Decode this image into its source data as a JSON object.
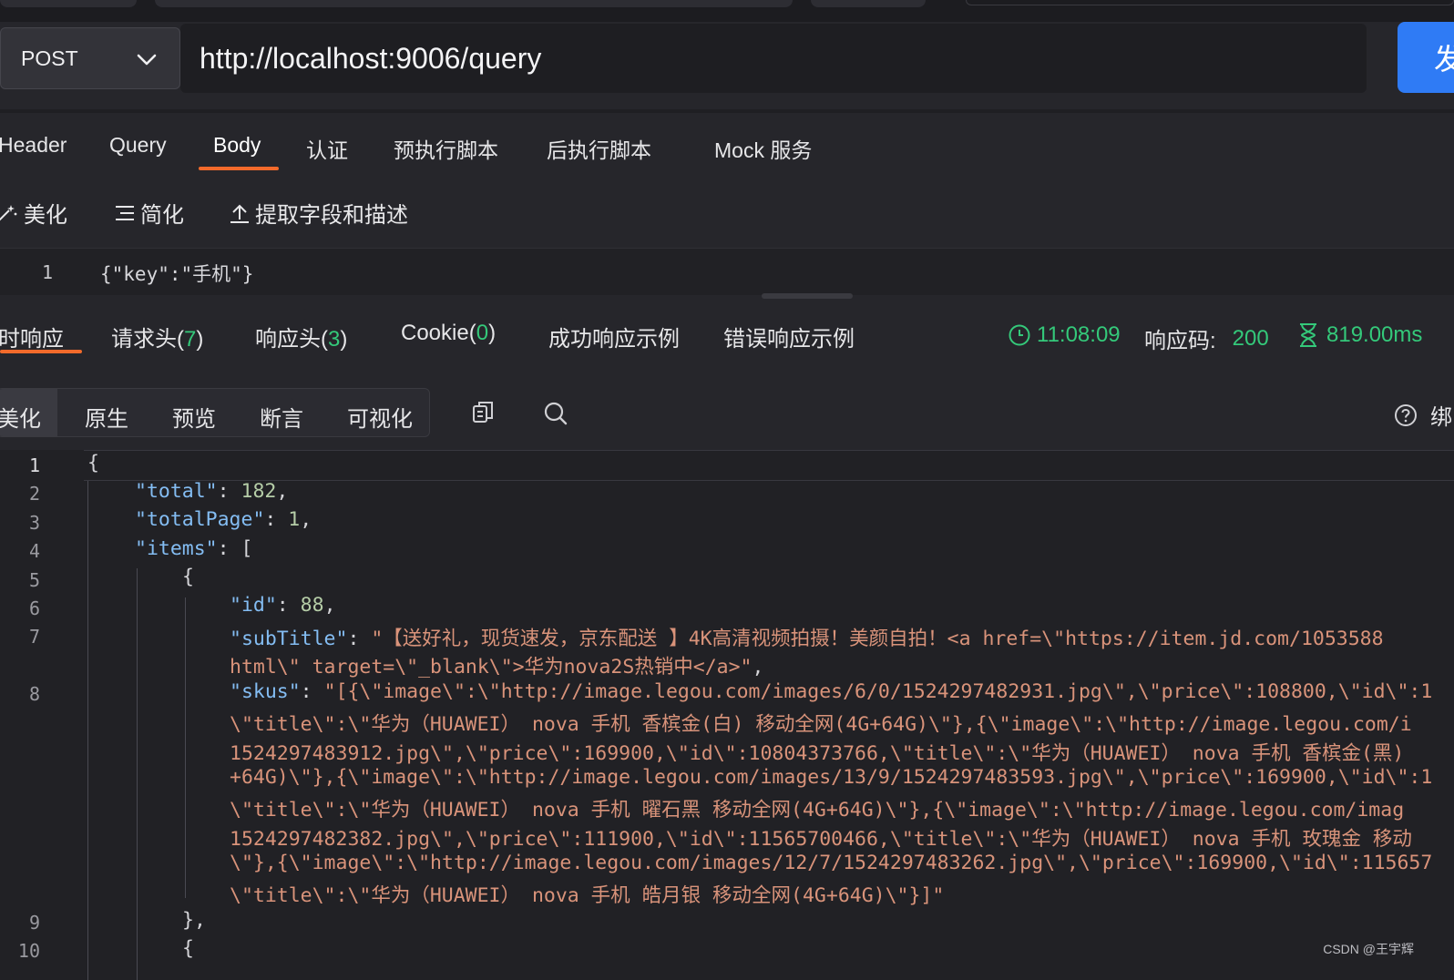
{
  "request": {
    "method": "POST",
    "url": "http://localhost:9006/query",
    "send_label": "发",
    "tabs": [
      "Header",
      "Query",
      "Body",
      "认证",
      "预执行脚本",
      "后执行脚本",
      "Mock 服务"
    ],
    "active_tab": "Body",
    "body_tools": {
      "beautify": "美化",
      "simplify": "简化",
      "extract": "提取字段和描述"
    },
    "body_line_number": "1",
    "body": "{\"key\":\"手机\"}"
  },
  "response": {
    "tabs": {
      "realtime": "时响应",
      "req_headers": "请求头(",
      "req_headers_count": "7",
      "resp_headers": "响应头(",
      "resp_headers_count": "3",
      "cookie": "Cookie(",
      "cookie_count": "0",
      "close_paren": ")",
      "success_example": "成功响应示例",
      "error_example": "错误响应示例"
    },
    "time": "11:08:09",
    "status_label": "响应码:",
    "status_code": "200",
    "duration": "819.00ms",
    "view_modes": [
      "美化",
      "原生",
      "预览",
      "断言",
      "可视化"
    ],
    "active_view": "美化",
    "bind_label": "绑",
    "line_numbers": [
      "1",
      "2",
      "3",
      "4",
      "5",
      "6",
      "7",
      "8",
      "9",
      "10"
    ],
    "code": {
      "l1": "{",
      "total_key": "\"total\"",
      "total_val": "182",
      "totalpage_key": "\"totalPage\"",
      "totalpage_val": "1",
      "items_key": "\"items\"",
      "items_open": "[",
      "obj_open": "{",
      "id_key": "\"id\"",
      "id_val": "88",
      "subtitle_key": "\"subTitle\"",
      "subtitle_val_1": "\"【送好礼，现货速发，京东配送 】4K高清视频拍摄！美颜自拍！<a href=\\\"https://item.jd.com/1053588",
      "subtitle_val_2": "html\\\" target=\\\"_blank\\\">华为nova2S热销中</a>\"",
      "skus_key": "\"skus\"",
      "skus_val_1": "\"[{\\\"image\\\":\\\"http://image.legou.com/images/6/0/1524297482931.jpg\\\",\\\"price\\\":108800,\\\"id\\\":1",
      "skus_val_2": "\\\"title\\\":\\\"华为（HUAWEI） nova 手机 香槟金(白) 移动全网(4G+64G)\\\"},{\\\"image\\\":\\\"http://image.legou.com/i",
      "skus_val_3": "1524297483912.jpg\\\",\\\"price\\\":169900,\\\"id\\\":10804373766,\\\"title\\\":\\\"华为（HUAWEI） nova 手机 香槟金(黑)",
      "skus_val_4": "+64G)\\\"},{\\\"image\\\":\\\"http://image.legou.com/images/13/9/1524297483593.jpg\\\",\\\"price\\\":169900,\\\"id\\\":1",
      "skus_val_5": "\\\"title\\\":\\\"华为（HUAWEI） nova 手机 曜石黑 移动全网(4G+64G)\\\"},{\\\"image\\\":\\\"http://image.legou.com/imag",
      "skus_val_6": "1524297482382.jpg\\\",\\\"price\\\":111900,\\\"id\\\":11565700466,\\\"title\\\":\\\"华为（HUAWEI） nova 手机 玫瑰金 移动",
      "skus_val_7": "\\\"},{\\\"image\\\":\\\"http://image.legou.com/images/12/7/1524297483262.jpg\\\",\\\"price\\\":169900,\\\"id\\\":115657",
      "skus_val_8": "\\\"title\\\":\\\"华为（HUAWEI） nova 手机 皓月银 移动全网(4G+64G)\\\"}]\"",
      "obj_close": "},",
      "obj_open2": "{"
    }
  },
  "watermark": "CSDN @王宇辉",
  "colors": {
    "accent": "#f26a2b",
    "success": "#34c97a",
    "send_button": "#2f7bf5",
    "json_key": "#84bdf3",
    "json_number": "#b6cea8",
    "json_string": "#d9937a"
  }
}
